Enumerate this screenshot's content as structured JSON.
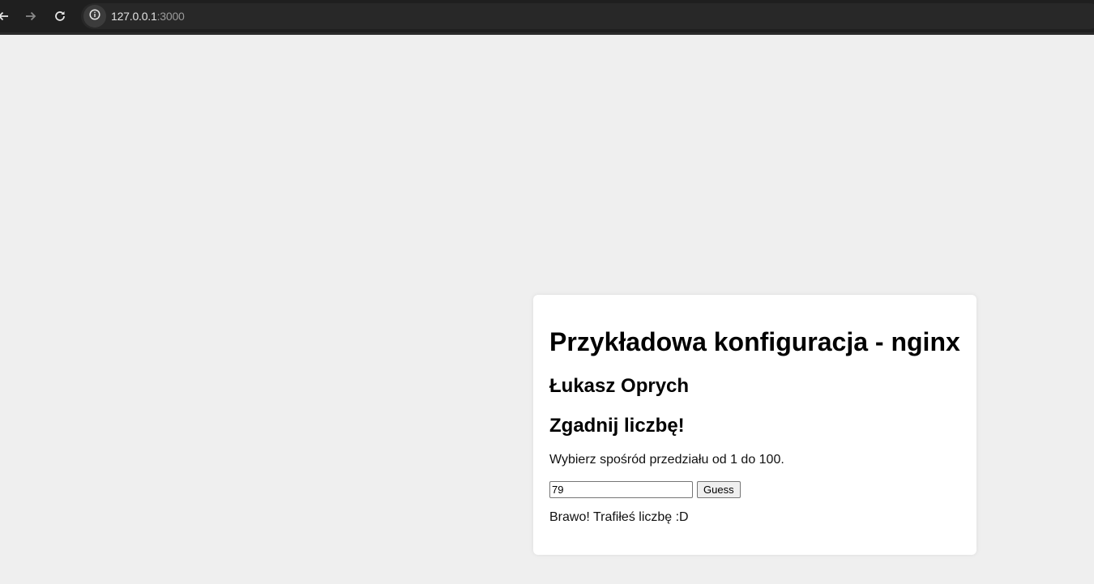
{
  "browser": {
    "url_host": "127.0.0.1",
    "url_port": ":3000"
  },
  "card": {
    "title": "Przykładowa konfiguracja - nginx",
    "author": "Łukasz Oprych",
    "game_title": "Zgadnij liczbę!",
    "instructions": "Wybierz spośród przedziału od 1 do 100.",
    "guess_value": "79",
    "guess_button_label": "Guess",
    "result": "Brawo! Trafiłeś liczbę :D"
  },
  "icons": {
    "back": "arrow-left-icon",
    "forward": "arrow-right-icon",
    "reload": "reload-icon",
    "site_info": "info-icon"
  }
}
